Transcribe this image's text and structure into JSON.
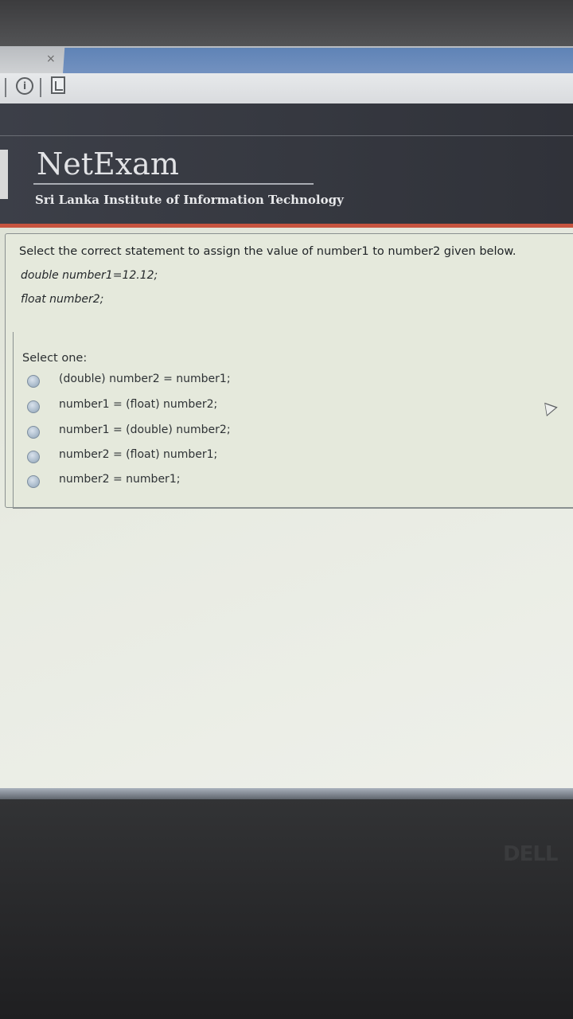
{
  "browser": {
    "close_glyph": "×",
    "info_icon": "info-icon",
    "page_icon": "document-icon"
  },
  "header": {
    "brand": "NetExam",
    "institute": "Sri Lanka Institute of Information Technology"
  },
  "question": {
    "text": "Select the correct statement to assign the value of number1 to number2 given below.",
    "code_lines": [
      "double number1=12.12;",
      "float number2;"
    ],
    "select_one": "Select one:",
    "options": [
      "(double) number2 = number1;",
      "number1 = (float) number2;",
      "number1 = (double) number2;",
      "number2 = (float) number1;",
      "number2 = number1;"
    ]
  },
  "monitor": {
    "brand": "DELL"
  },
  "colors": {
    "header_bg": "#353840",
    "header_accent": "#c7543f",
    "page_bg": "#e5e9dc"
  }
}
